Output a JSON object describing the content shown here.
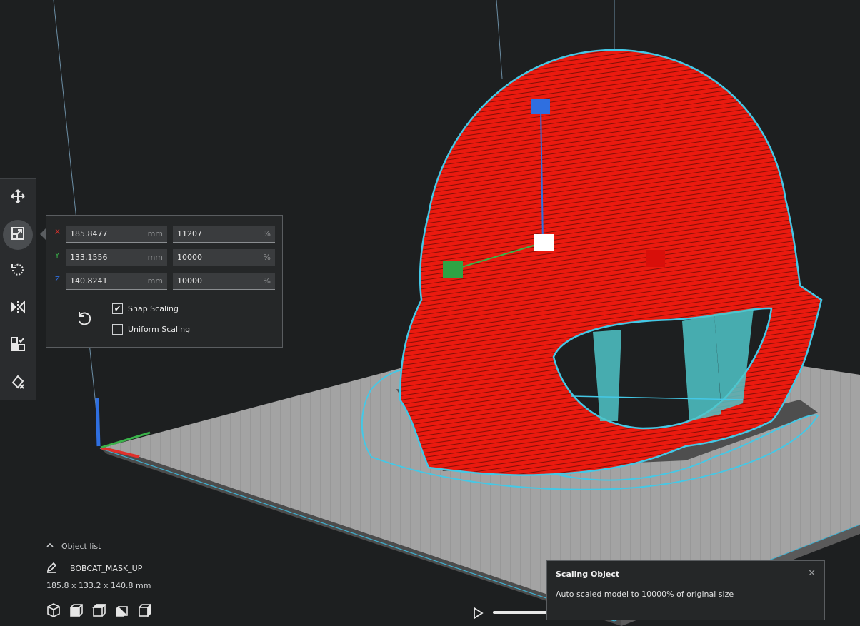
{
  "icons": {
    "translate": "move-arrows-icon",
    "scale": "scale-icon",
    "rotate": "rotate-icon",
    "mirror": "mirror-icon",
    "per_model": "per-model-settings-icon",
    "support_blocker": "support-blocker-icon"
  },
  "scale_panel": {
    "x": {
      "axis": "X",
      "mm": "185.8477",
      "mm_unit": "mm",
      "percent": "11207",
      "percent_unit": "%"
    },
    "y": {
      "axis": "Y",
      "mm": "133.1556",
      "mm_unit": "mm",
      "percent": "10000",
      "percent_unit": "%"
    },
    "z": {
      "axis": "Z",
      "mm": "140.8241",
      "mm_unit": "mm",
      "percent": "10000",
      "percent_unit": "%"
    },
    "snap_scaling": {
      "label": "Snap Scaling",
      "checked": true
    },
    "uniform_scaling": {
      "label": "Uniform Scaling",
      "checked": false
    }
  },
  "object_list": {
    "header": "Object list",
    "object_name": "BOBCAT_MASK_UP",
    "dimensions": "185.8 x 133.2 x 140.8 mm"
  },
  "message": {
    "title": "Scaling Object",
    "body": "Auto scaled model to 10000% of original size"
  },
  "colors": {
    "axis_x": "#e0302b",
    "axis_y": "#3ab34a",
    "axis_z": "#2f6fe0",
    "model": "#e4160e",
    "outline": "#44c8e6",
    "build_plate": "#9a9a9a"
  }
}
